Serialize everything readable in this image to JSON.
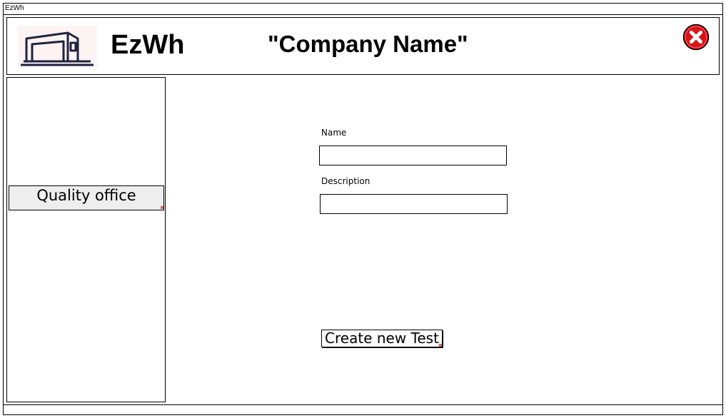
{
  "window": {
    "title": "EzWh"
  },
  "header": {
    "app_name": "EzWh",
    "company_name": "\"Company Name\"",
    "logo_icon": "warehouse-icon",
    "close_icon": "close-icon",
    "close_color": "#d7141a"
  },
  "sidebar": {
    "items": [
      {
        "label": "Quality office"
      }
    ]
  },
  "form": {
    "name": {
      "label": "Name",
      "value": ""
    },
    "description": {
      "label": "Description",
      "value": ""
    },
    "submit_label": "Create new Test"
  }
}
